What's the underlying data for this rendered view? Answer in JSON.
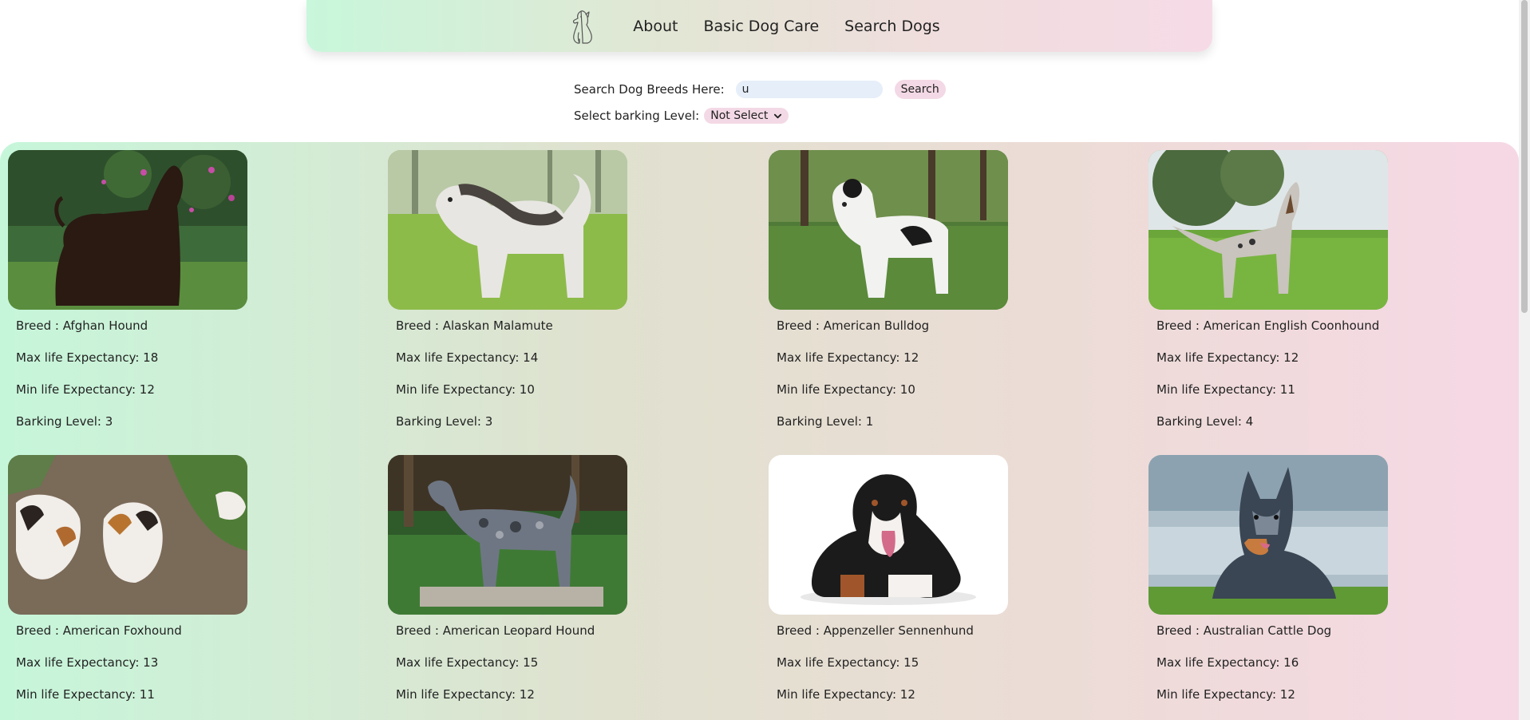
{
  "nav": {
    "logo_icon": "dog-outline-icon",
    "links": [
      "About",
      "Basic Dog Care",
      "Search Dogs"
    ]
  },
  "search": {
    "label": "Search Dog Breeds Here:",
    "value": "u",
    "button": "Search"
  },
  "barking_filter": {
    "label": "Select barking Level:",
    "selected": "Not Select"
  },
  "dogs": [
    {
      "breed": "Breed : Afghan Hound",
      "max_life": "Max life Expectancy: 18",
      "min_life": "Min life Expectancy: 12",
      "barking": "Barking Level: 3"
    },
    {
      "breed": "Breed : Alaskan Malamute",
      "max_life": "Max life Expectancy: 14",
      "min_life": "Min life Expectancy: 10",
      "barking": "Barking Level: 3"
    },
    {
      "breed": "Breed : American Bulldog",
      "max_life": "Max life Expectancy: 12",
      "min_life": "Min life Expectancy: 10",
      "barking": "Barking Level: 1"
    },
    {
      "breed": "Breed : American English Coonhound",
      "max_life": "Max life Expectancy: 12",
      "min_life": "Min life Expectancy: 11",
      "barking": "Barking Level: 4"
    },
    {
      "breed": "Breed : American Foxhound",
      "max_life": "Max life Expectancy: 13",
      "min_life": "Min life Expectancy: 11"
    },
    {
      "breed": "Breed : American Leopard Hound",
      "max_life": "Max life Expectancy: 15",
      "min_life": "Min life Expectancy: 12"
    },
    {
      "breed": "Breed : Appenzeller Sennenhund",
      "max_life": "Max life Expectancy: 15",
      "min_life": "Min life Expectancy: 12"
    },
    {
      "breed": "Breed : Australian Cattle Dog",
      "max_life": "Max life Expectancy: 16",
      "min_life": "Min life Expectancy: 12"
    }
  ],
  "colors": {
    "gradient_green": "#c6f6da",
    "gradient_pink": "#f6d8e5",
    "search_input_bg": "#e6eef9",
    "button_bg": "#f3d9e5"
  }
}
